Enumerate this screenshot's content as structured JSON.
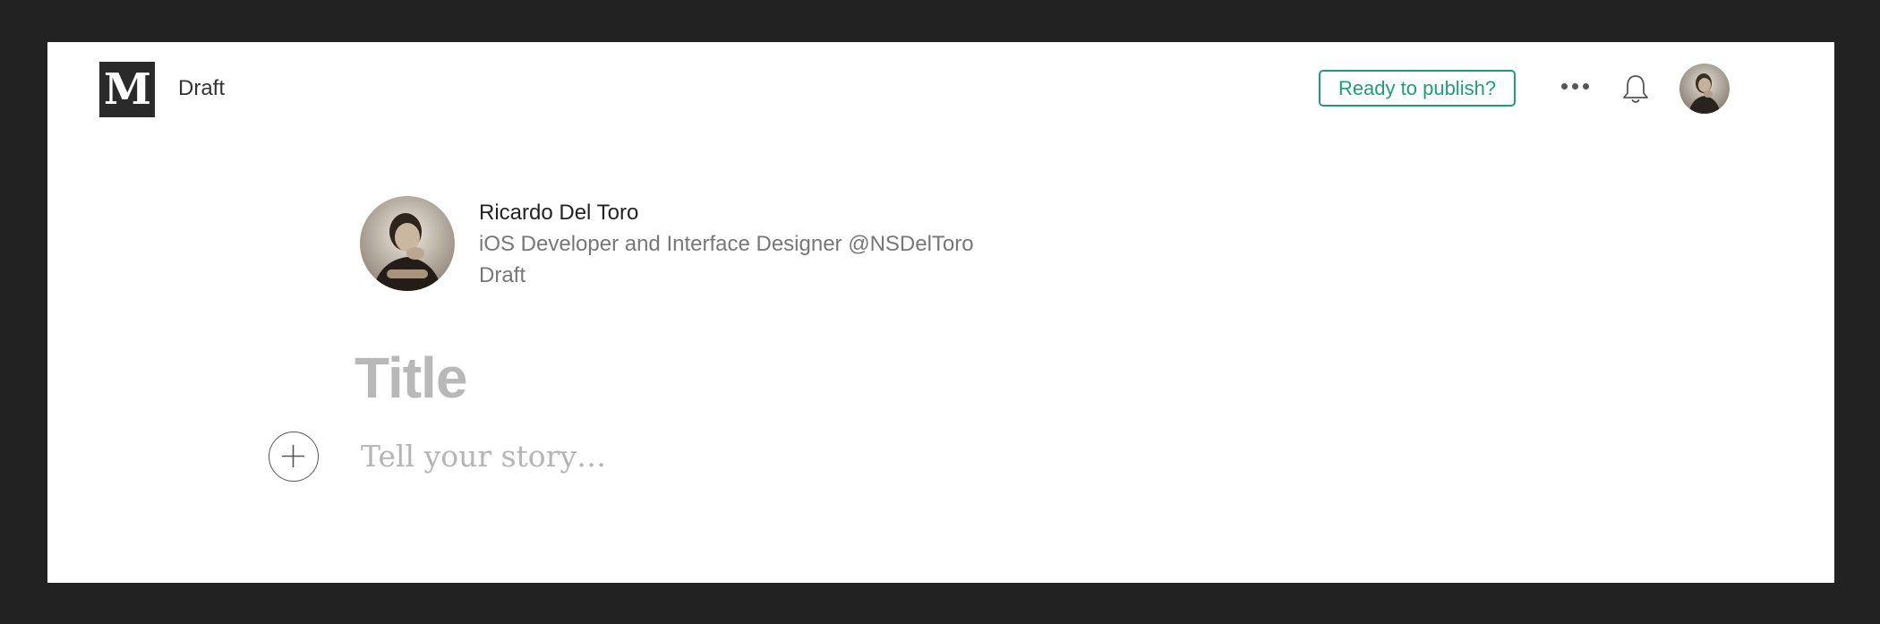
{
  "header": {
    "logo_letter": "M",
    "status": "Draft",
    "publish_label": "Ready to publish?",
    "more_icon": "more-dots-icon",
    "bell_icon": "bell-icon",
    "accent_color": "#1a9f7a"
  },
  "author": {
    "name": "Ricardo Del Toro",
    "bio": "iOS Developer and Interface Designer @NSDelToro",
    "status": "Draft"
  },
  "editor": {
    "title_placeholder": "Title",
    "story_placeholder": "Tell your story…",
    "add_icon": "plus-circle-icon"
  }
}
